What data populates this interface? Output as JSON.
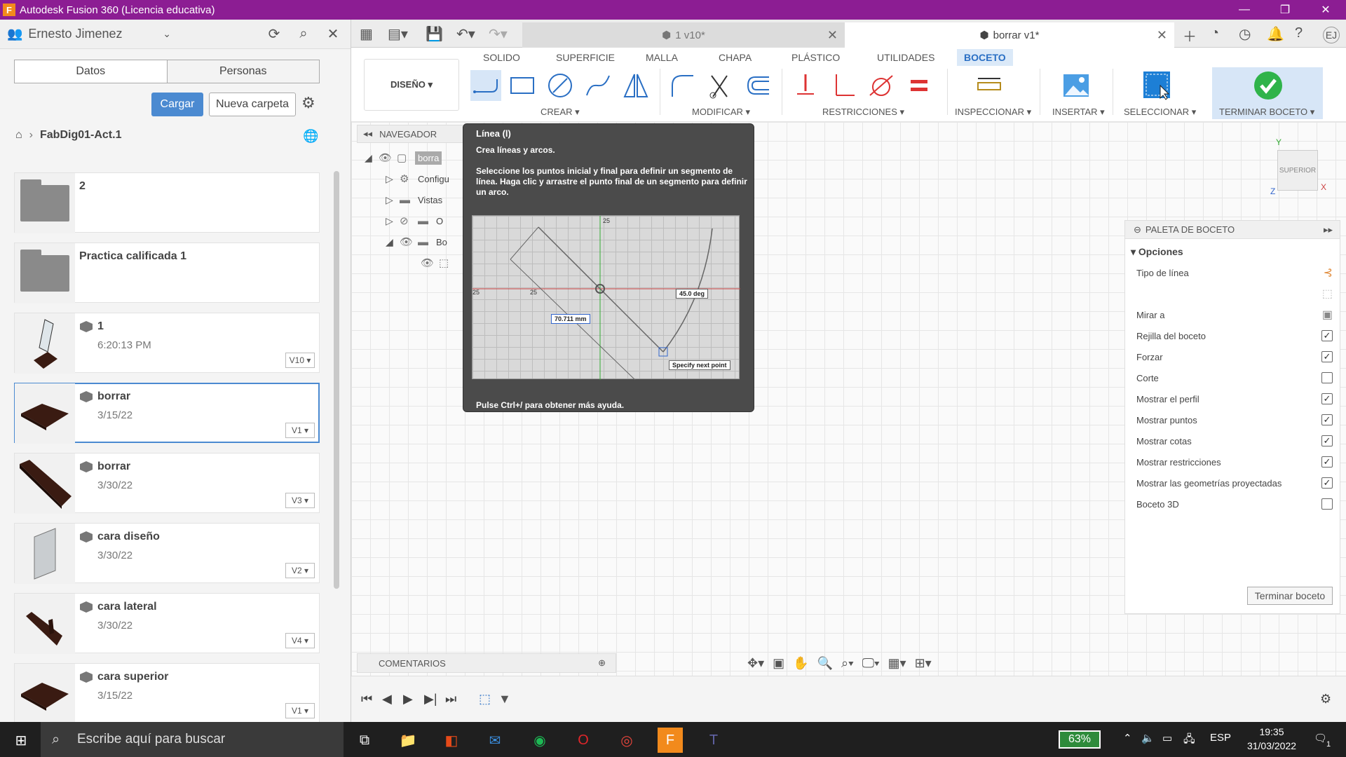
{
  "window": {
    "title": "Autodesk Fusion 360 (Licencia educativa)"
  },
  "data_panel": {
    "user": "Ernesto Jimenez",
    "tabs": [
      "Datos",
      "Personas"
    ],
    "upload_button": "Cargar",
    "new_folder_button": "Nueva carpeta",
    "breadcrumb": "FabDig01-Act.1",
    "items": [
      {
        "name": "2",
        "type": "folder"
      },
      {
        "name": "Practica calificada 1",
        "type": "folder"
      },
      {
        "name": "1",
        "date": "6:20:13 PM",
        "version": "V10 ▾"
      },
      {
        "name": "borrar",
        "date": "3/15/22",
        "version": "V1 ▾"
      },
      {
        "name": "borrar",
        "date": "3/30/22",
        "version": "V3 ▾"
      },
      {
        "name": "cara diseño",
        "date": "3/30/22",
        "version": "V2 ▾"
      },
      {
        "name": "cara lateral",
        "date": "3/30/22",
        "version": "V4 ▾"
      },
      {
        "name": "cara superior",
        "date": "3/15/22",
        "version": "V1 ▾"
      }
    ]
  },
  "doc_tabs": [
    {
      "label": "1 v10*"
    },
    {
      "label": "borrar v1*"
    }
  ],
  "toolbar": {
    "workspace": "DISEÑO ▾",
    "tabs": [
      "SOLIDO",
      "SUPERFICIE",
      "MALLA",
      "CHAPA",
      "PLÁSTICO",
      "UTILIDADES",
      "BOCETO"
    ],
    "groups": [
      "CREAR ▾",
      "MODIFICAR ▾",
      "RESTRICCIONES ▾",
      "INSPECCIONAR ▾",
      "INSERTAR ▾",
      "SELECCIONAR ▾",
      "TERMINAR BOCETO ▾"
    ]
  },
  "navigator": {
    "title": "NAVEGADOR",
    "rows": [
      "borra",
      "Configu",
      "Vistas",
      "O",
      "Bo"
    ]
  },
  "tooltip": {
    "title": "Línea (l)",
    "subtitle": "Crea líneas y arcos.",
    "body": "Seleccione los puntos inicial y final para definir un segmento de línea. Haga clic y arrastre el punto final de un segmento para definir un arco.",
    "footer": "Pulse Ctrl+/ para obtener más ayuda.",
    "image_labels": {
      "length": "70.711 mm",
      "angle": "45.0 deg",
      "prompt": "Specify next point",
      "tick_a": "25",
      "tick_b": "25",
      "tick_c": "25"
    }
  },
  "viewcube": {
    "label": "SUPERIOR",
    "axis_x": "X",
    "axis_y": "Y",
    "axis_z": "Z"
  },
  "sketch_palette": {
    "title": "PALETA DE BOCETO",
    "section": "Opciones",
    "rows": [
      {
        "label": "Tipo de línea",
        "kind": "icon"
      },
      {
        "label": "",
        "kind": "icon"
      },
      {
        "label": "Mirar a",
        "kind": "icon"
      },
      {
        "label": "Rejilla del boceto",
        "kind": "check",
        "checked": true
      },
      {
        "label": "Forzar",
        "kind": "check",
        "checked": true
      },
      {
        "label": "Corte",
        "kind": "check",
        "checked": false
      },
      {
        "label": "Mostrar el perfil",
        "kind": "check",
        "checked": true
      },
      {
        "label": "Mostrar puntos",
        "kind": "check",
        "checked": true
      },
      {
        "label": "Mostrar cotas",
        "kind": "check",
        "checked": true
      },
      {
        "label": "Mostrar restricciones",
        "kind": "check",
        "checked": true
      },
      {
        "label": "Mostrar las geometrías proyectadas",
        "kind": "check",
        "checked": true
      },
      {
        "label": "Boceto 3D",
        "kind": "check",
        "checked": false
      }
    ],
    "finish_button": "Terminar boceto"
  },
  "comments": {
    "label": "COMENTARIOS"
  },
  "taskbar": {
    "search_placeholder": "Escribe aquí para buscar",
    "battery": "63%",
    "language": "ESP",
    "time": "19:35",
    "date": "31/03/2022",
    "notifications": "1"
  },
  "colors": {
    "titlebar": "#8c1d93",
    "accent": "#4b8ad1",
    "finish": "#2fb34a"
  }
}
